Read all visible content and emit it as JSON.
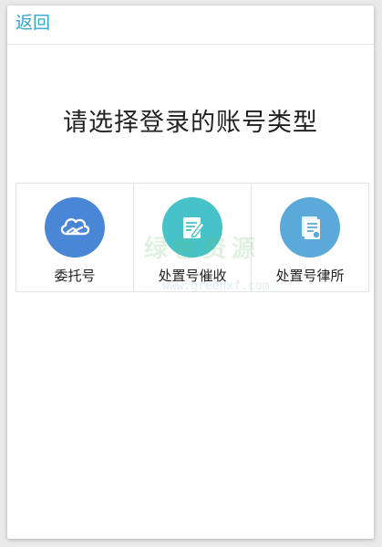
{
  "header": {
    "back_label": "返回"
  },
  "main": {
    "title": "请选择登录的账号类型",
    "options": [
      {
        "label": "委托号",
        "icon": "cloud-handshake-icon",
        "color": "#4a86d6"
      },
      {
        "label": "处置号催收",
        "icon": "document-edit-icon",
        "color": "#46c2c8"
      },
      {
        "label": "处置号律所",
        "icon": "document-list-icon",
        "color": "#5aa9d8"
      }
    ]
  },
  "watermark": {
    "text": "绿色资源",
    "sub": "www.greenxf.com"
  },
  "colors": {
    "accent": "#33a6c9"
  }
}
